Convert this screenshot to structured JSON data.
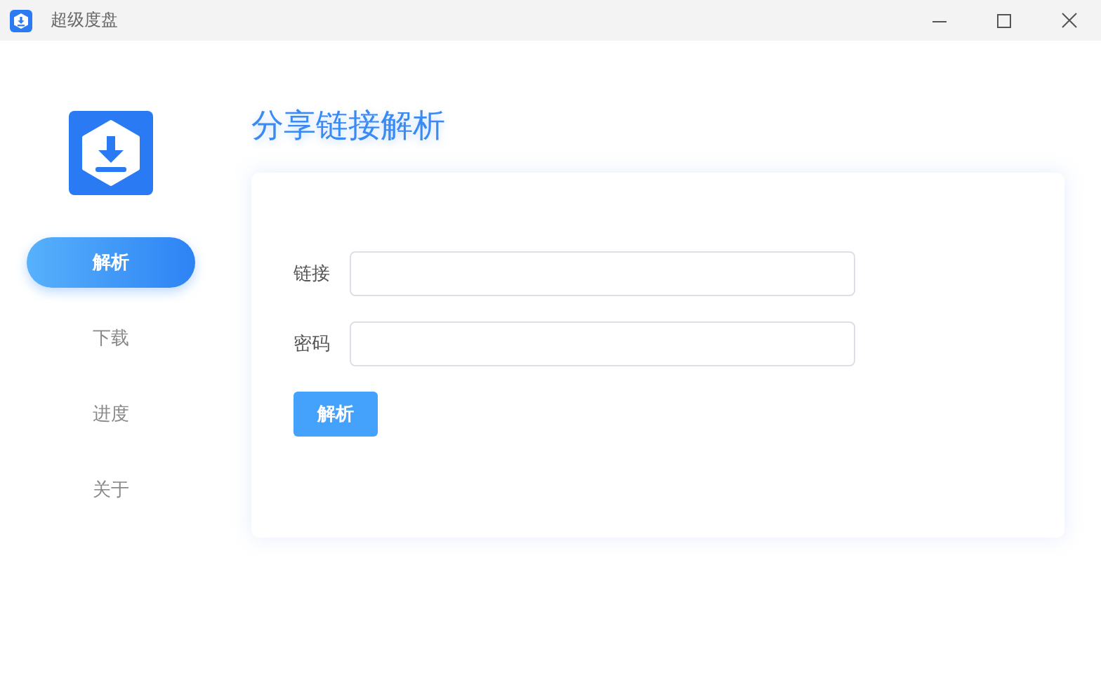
{
  "window": {
    "title": "超级度盘"
  },
  "sidebar": {
    "items": [
      {
        "label": "解析",
        "selected": true
      },
      {
        "label": "下载",
        "selected": false
      },
      {
        "label": "进度",
        "selected": false
      },
      {
        "label": "关于",
        "selected": false
      }
    ]
  },
  "main": {
    "title": "分享链接解析",
    "fields": [
      {
        "label": "链接"
      },
      {
        "label": "密码"
      }
    ],
    "submit": "解析"
  }
}
